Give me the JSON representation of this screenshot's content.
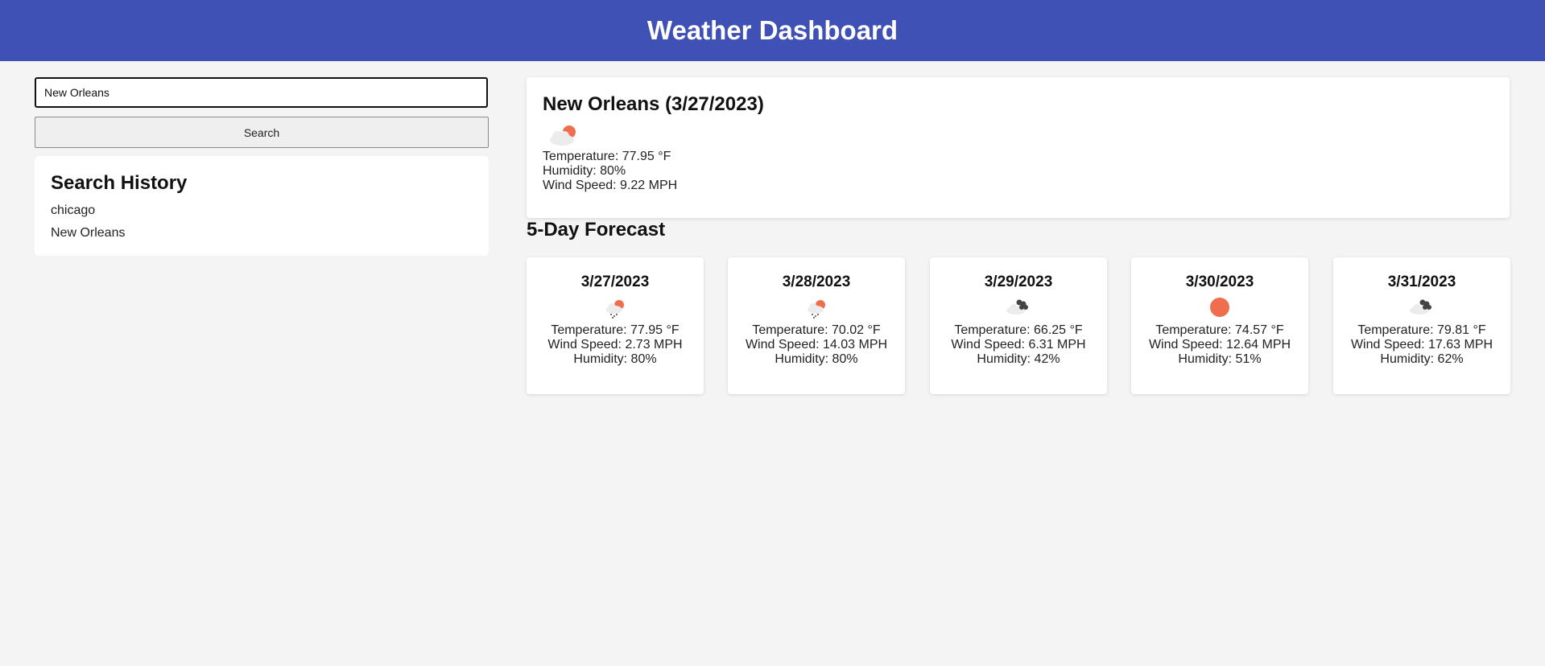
{
  "header": {
    "title": "Weather Dashboard",
    "background": "#4051b5"
  },
  "search": {
    "value": "New Orleans",
    "button_label": "Search"
  },
  "history": {
    "title": "Search History",
    "items": [
      "chicago",
      "New Orleans"
    ]
  },
  "current": {
    "title": "New Orleans (3/27/2023)",
    "icon": "cloud-sun-icon",
    "temperature": "Temperature: 77.95 °F",
    "humidity": "Humidity: 80%",
    "wind": "Wind Speed: 9.22 MPH"
  },
  "forecast": {
    "title": "5-Day Forecast",
    "days": [
      {
        "date": "3/27/2023",
        "icon": "rain-sun-icon",
        "temperature": "Temperature: 77.95 °F",
        "wind": "Wind Speed: 2.73 MPH",
        "humidity": "Humidity: 80%"
      },
      {
        "date": "3/28/2023",
        "icon": "rain-sun-icon",
        "temperature": "Temperature: 70.02 °F",
        "wind": "Wind Speed: 14.03 MPH",
        "humidity": "Humidity: 80%"
      },
      {
        "date": "3/29/2023",
        "icon": "broken-clouds-icon",
        "temperature": "Temperature: 66.25 °F",
        "wind": "Wind Speed: 6.31 MPH",
        "humidity": "Humidity: 42%"
      },
      {
        "date": "3/30/2023",
        "icon": "clear-sun-icon",
        "temperature": "Temperature: 74.57 °F",
        "wind": "Wind Speed: 12.64 MPH",
        "humidity": "Humidity: 51%"
      },
      {
        "date": "3/31/2023",
        "icon": "broken-clouds-icon",
        "temperature": "Temperature: 79.81 °F",
        "wind": "Wind Speed: 17.63 MPH",
        "humidity": "Humidity: 62%"
      }
    ]
  },
  "colors": {
    "sun": "#ee6e4d",
    "cloud_light": "#e9e9e9",
    "cloud_dark": "#444444"
  }
}
